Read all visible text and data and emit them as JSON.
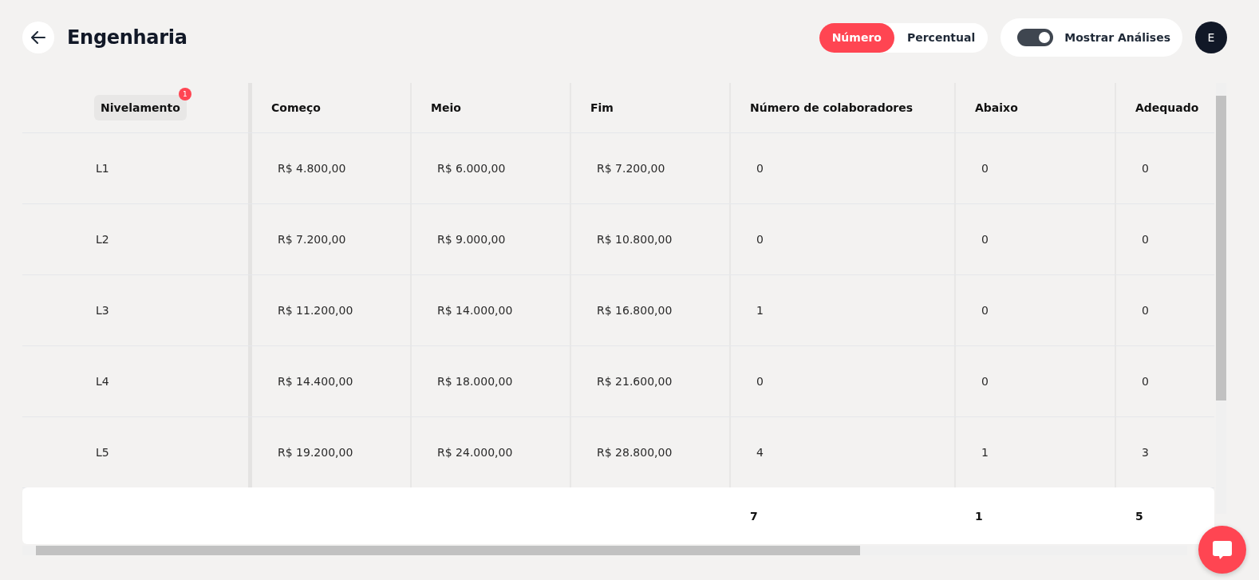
{
  "header": {
    "title": "Engenharia",
    "mode_options": [
      {
        "label": "Número",
        "selected": true
      },
      {
        "label": "Percentual",
        "selected": false
      }
    ],
    "analysis_toggle": {
      "label": "Mostrar Análises",
      "on": true
    },
    "avatar": "E"
  },
  "table": {
    "columns": [
      {
        "label": "Nivelamento",
        "badge": "1"
      },
      {
        "label": "Começo"
      },
      {
        "label": "Meio"
      },
      {
        "label": "Fim"
      },
      {
        "label": "Número de colaboradores",
        "total": "7"
      },
      {
        "label": "Abaixo",
        "total": "1"
      },
      {
        "label": "Adequado",
        "total": "5"
      }
    ],
    "rows": [
      [
        "L1",
        "R$ 4.800,00",
        "R$ 6.000,00",
        "R$ 7.200,00",
        "0",
        "0",
        "0"
      ],
      [
        "L2",
        "R$ 7.200,00",
        "R$ 9.000,00",
        "R$ 10.800,00",
        "0",
        "0",
        "0"
      ],
      [
        "L3",
        "R$ 11.200,00",
        "R$ 14.000,00",
        "R$ 16.800,00",
        "1",
        "0",
        "0"
      ],
      [
        "L4",
        "R$ 14.400,00",
        "R$ 18.000,00",
        "R$ 21.600,00",
        "0",
        "0",
        "0"
      ],
      [
        "L5",
        "R$ 19.200,00",
        "R$ 24.000,00",
        "R$ 28.800,00",
        "4",
        "1",
        "3"
      ]
    ]
  }
}
